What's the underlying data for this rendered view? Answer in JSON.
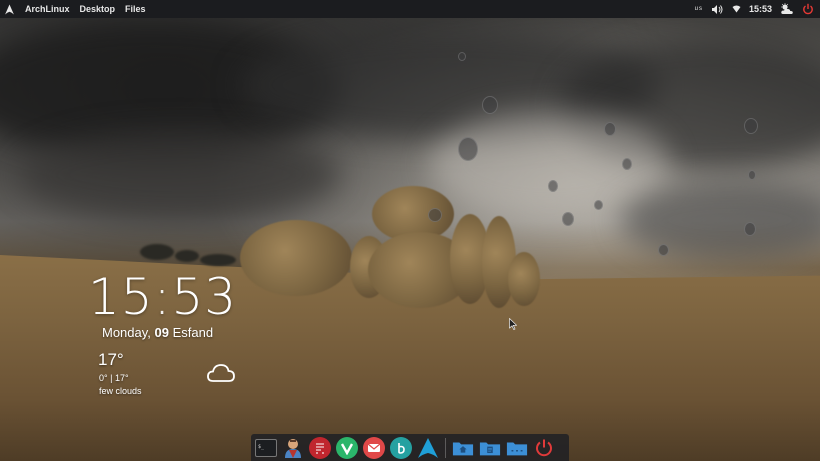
{
  "top_panel": {
    "distro_label": "ArchLinux",
    "menu_items": [
      "Desktop",
      "Files"
    ],
    "keyboard_layout": "us",
    "time": "15:53"
  },
  "clock_widget": {
    "hours": "15",
    "separator": ":",
    "minutes": "53",
    "weekday": "Monday, ",
    "day": "09",
    "month": " Esfand"
  },
  "weather_widget": {
    "temperature": "17°",
    "range": "0° | 17°",
    "description": "few clouds",
    "icon": "cloud-icon"
  },
  "dock": {
    "apps": [
      {
        "name": "terminal",
        "icon": "terminal-icon",
        "color": "#2b2d30"
      },
      {
        "name": "user",
        "icon": "avatar-icon",
        "color": "#4a4f58"
      },
      {
        "name": "task-manager",
        "icon": "tasks-icon",
        "color": "#c0262e"
      },
      {
        "name": "vim",
        "icon": "vim-icon",
        "color": "#2bb56a"
      },
      {
        "name": "mail",
        "icon": "mail-icon",
        "color": "#e04848"
      },
      {
        "name": "torrent",
        "icon": "torrent-icon",
        "color": "#25a1a1"
      },
      {
        "name": "arch",
        "icon": "arch-icon",
        "color": "#1fa0d8"
      }
    ],
    "places": [
      {
        "name": "home-folder",
        "icon": "home-folder-icon",
        "color": "#3c8fd6"
      },
      {
        "name": "documents-folder",
        "icon": "documents-folder-icon",
        "color": "#3c8fd6"
      },
      {
        "name": "other-folder",
        "icon": "folder-icon",
        "color": "#3c8fd6"
      }
    ],
    "power": {
      "icon": "power-icon",
      "color": "#e03a3a"
    }
  }
}
